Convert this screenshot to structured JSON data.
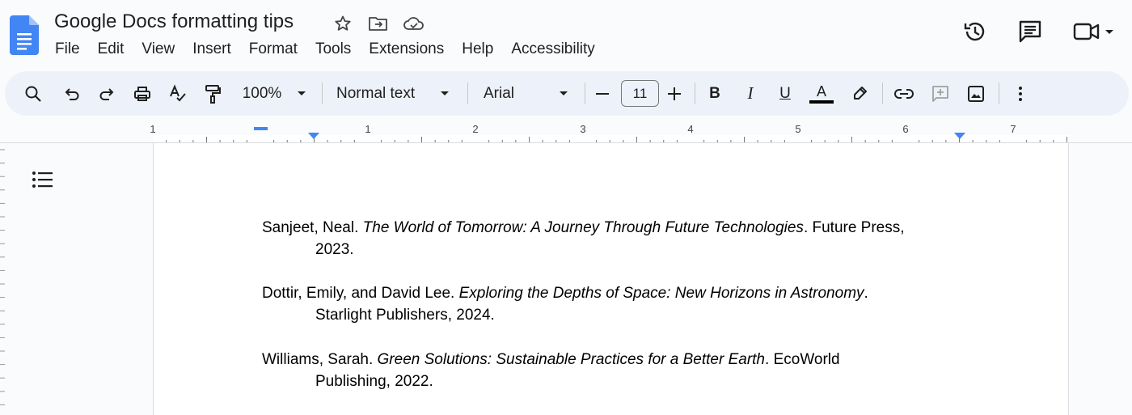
{
  "app": {
    "doc_title": "Google Docs formatting tips",
    "brand_color": "#4285f4"
  },
  "menu": [
    "File",
    "Edit",
    "View",
    "Insert",
    "Format",
    "Tools",
    "Extensions",
    "Help",
    "Accessibility"
  ],
  "title_icons": [
    "star-icon",
    "move-folder-icon",
    "cloud-saved-icon"
  ],
  "right_icons": [
    "version-history-icon",
    "comments-icon",
    "meet-icon",
    "dropdown-arrow-icon"
  ],
  "toolbar": {
    "zoom": "100%",
    "style": "Normal text",
    "font": "Arial",
    "font_size": "11",
    "bold": "B",
    "italic": "I",
    "underline": "U",
    "text_color": "A",
    "icons": [
      "search-icon",
      "undo-icon",
      "redo-icon",
      "print-icon",
      "spellcheck-icon",
      "paint-format-icon",
      "decrease-font-icon",
      "increase-font-icon",
      "highlight-icon",
      "link-icon",
      "add-comment-icon",
      "insert-image-icon",
      "more-options-icon"
    ]
  },
  "ruler": {
    "labels": [
      "1",
      "1",
      "2",
      "3",
      "4",
      "5",
      "6",
      "7"
    ]
  },
  "document": {
    "entries": [
      {
        "author": "Sanjeet, Neal. ",
        "title": "The World of Tomorrow: A Journey Through Future Technologies",
        "publisher_line1": ". Future Press,",
        "line2": "2023."
      },
      {
        "author": "Dottir, Emily, and David Lee. ",
        "title": "Exploring the Depths of Space: New Horizons in Astronomy",
        "publisher_line1": ".",
        "line2": "Starlight Publishers, 2024."
      },
      {
        "author": "Williams, Sarah. ",
        "title": "Green Solutions: Sustainable Practices for a Better Earth",
        "publisher_line1": ". EcoWorld",
        "line2": "Publishing, 2022."
      }
    ]
  }
}
